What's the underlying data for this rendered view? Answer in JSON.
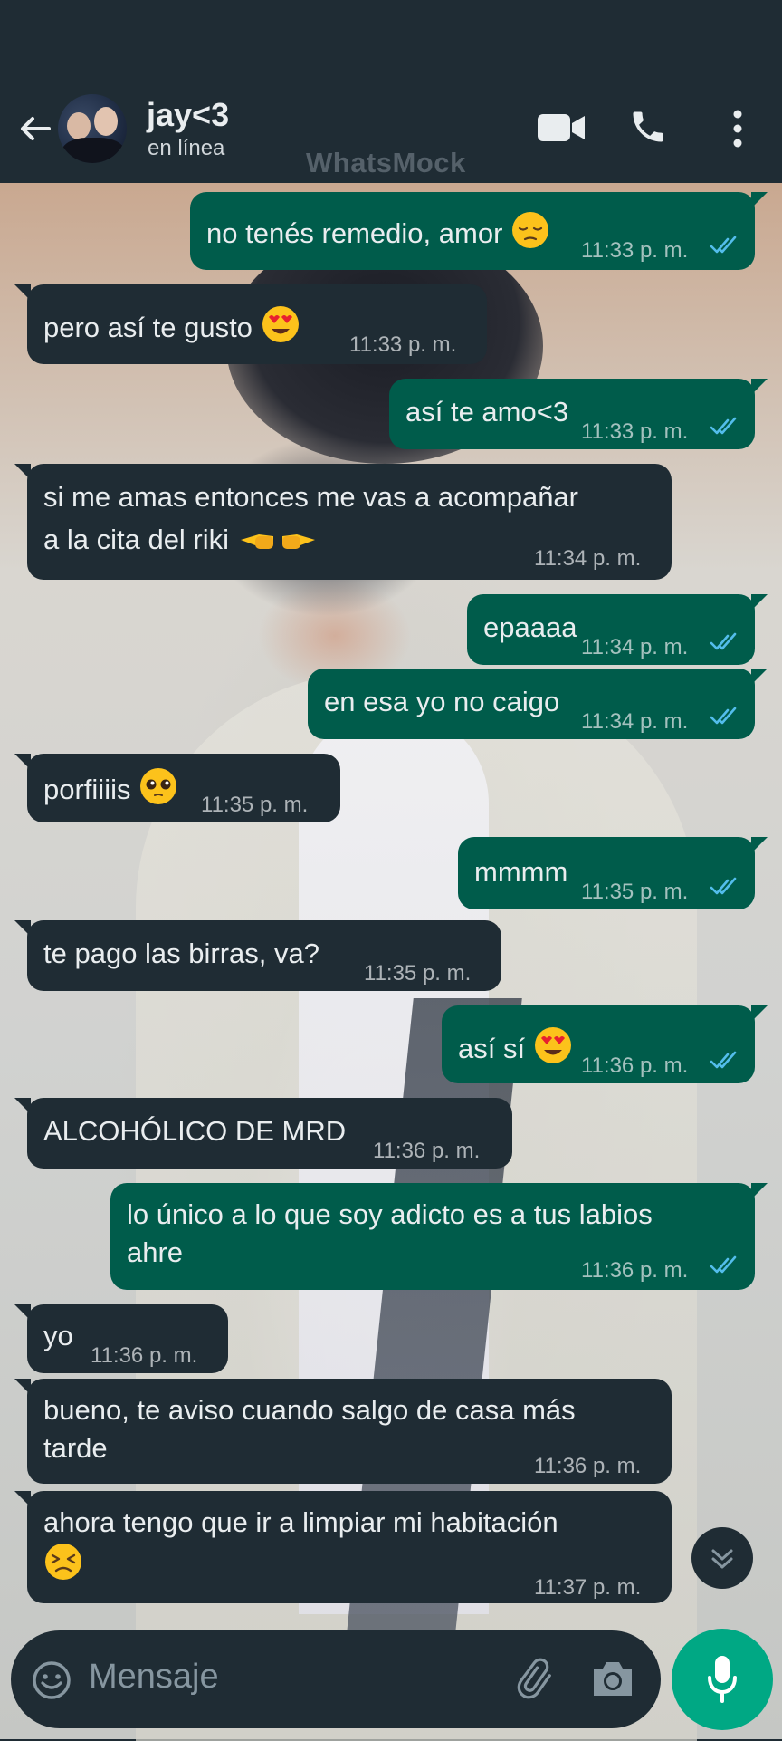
{
  "header": {
    "contact_name": "jay<3",
    "status": "en línea",
    "watermark": "WhatsMock"
  },
  "messages": [
    {
      "dir": "out",
      "lines": [
        "no tenés remedio, amor"
      ],
      "emoji": "pensive-face",
      "time": "11:33 p. m.",
      "read": true
    },
    {
      "dir": "in",
      "lines": [
        "pero así te gusto "
      ],
      "emoji": "heart-eyes-face",
      "time": "11:33 p. m."
    },
    {
      "dir": "out",
      "lines": [
        "así te amo<3"
      ],
      "time": "11:33 p. m.",
      "read": true
    },
    {
      "dir": "in",
      "lines": [
        "si me amas entonces me vas a acompañar",
        "a la cita del riki "
      ],
      "emoji": "pointing-hands",
      "time": "11:34 p. m."
    },
    {
      "dir": "out",
      "lines": [
        "epaaaa"
      ],
      "time": "11:34 p. m.",
      "read": true
    },
    {
      "dir": "out",
      "lines": [
        "en esa yo no caigo"
      ],
      "time": "11:34 p. m.",
      "read": true
    },
    {
      "dir": "in",
      "lines": [
        "porfiiiis"
      ],
      "emoji": "pleading-face",
      "time": "11:35 p. m."
    },
    {
      "dir": "out",
      "lines": [
        "mmmm"
      ],
      "time": "11:35 p. m.",
      "read": true
    },
    {
      "dir": "in",
      "lines": [
        "te pago las birras, va?"
      ],
      "time": "11:35 p. m."
    },
    {
      "dir": "out",
      "lines": [
        "así sí "
      ],
      "emoji": "heart-eyes-face",
      "time": "11:36 p. m.",
      "read": true
    },
    {
      "dir": "in",
      "lines": [
        "ALCOHÓLICO DE MRD"
      ],
      "time": "11:36 p. m."
    },
    {
      "dir": "out",
      "lines": [
        "lo único a lo que soy adicto es a tus labios",
        "ahre"
      ],
      "time": "11:36 p. m.",
      "read": true
    },
    {
      "dir": "in",
      "lines": [
        "yo"
      ],
      "time": "11:36 p. m."
    },
    {
      "dir": "in",
      "lines": [
        "bueno, te aviso cuando salgo de casa más",
        "tarde"
      ],
      "time": "11:36 p. m."
    },
    {
      "dir": "in",
      "lines": [
        "ahora tengo que ir a limpiar mi habitación",
        ""
      ],
      "emoji": "persevering-face",
      "time": "11:37 p. m."
    }
  ],
  "input": {
    "placeholder": "Mensaje"
  },
  "icons": {
    "back": "back-arrow-icon",
    "video": "video-call-icon",
    "phone": "phone-call-icon",
    "more": "more-vertical-icon",
    "scroll": "chevron-double-down-icon",
    "emoji": "emoji-icon",
    "attach": "paperclip-icon",
    "camera": "camera-icon",
    "mic": "microphone-icon"
  },
  "colors": {
    "header_bg": "#1f2c34",
    "outgoing_bubble": "#005c4b",
    "incoming_bubble": "#1f2c34",
    "read_tick": "#53bdeb",
    "mic_button": "#00a884"
  }
}
